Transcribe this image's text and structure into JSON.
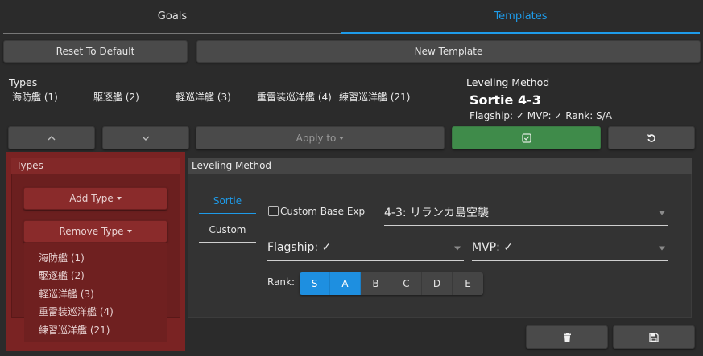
{
  "tabs": [
    {
      "label": "Goals",
      "active": false
    },
    {
      "label": "Templates",
      "active": true
    }
  ],
  "toolbar": {
    "reset_label": "Reset To Default",
    "new_template_label": "New Template"
  },
  "types_section": {
    "heading": "Types",
    "items": [
      "海防艦 (1)",
      "駆逐艦 (2)",
      "軽巡洋艦 (3)",
      "重雷装巡洋艦 (4)",
      "練習巡洋艦 (21)"
    ]
  },
  "leveling_method": {
    "heading": "Leveling Method",
    "title": "Sortie 4-3",
    "subtitle": "Flagship: ✓ MVP: ✓ Rank: S/A"
  },
  "actions": {
    "up_icon": "chevron-up-icon",
    "down_icon": "chevron-down-icon",
    "apply_to_label": "Apply to",
    "confirm_icon": "check-square-icon",
    "undo_icon": "undo-icon"
  },
  "types_panel": {
    "heading": "Types",
    "add_type_label": "Add Type",
    "remove_type_label": "Remove Type",
    "remove_options": [
      "海防艦 (1)",
      "駆逐艦 (2)",
      "軽巡洋艦 (3)",
      "重雷装巡洋艦 (4)",
      "練習巡洋艦 (21)"
    ]
  },
  "lm_panel": {
    "heading": "Leveling Method",
    "tab_sortie": "Sortie",
    "tab_custom": "Custom",
    "custom_base_exp_label": "Custom Base Exp",
    "custom_base_exp_checked": false,
    "map_value": "4-3: リランカ島空襲",
    "flagship_value": "Flagship: ✓",
    "mvp_value": "MVP: ✓",
    "rank_label": "Rank:",
    "ranks": [
      {
        "label": "S",
        "selected": true
      },
      {
        "label": "A",
        "selected": true
      },
      {
        "label": "B",
        "selected": false
      },
      {
        "label": "C",
        "selected": false
      },
      {
        "label": "D",
        "selected": false
      },
      {
        "label": "E",
        "selected": false
      }
    ]
  },
  "footer": {
    "delete_icon": "trash-icon",
    "save_icon": "save-icon"
  },
  "colors": {
    "accent": "#1e9be9",
    "success": "#3f8b4a",
    "danger_panel": "#7a2323",
    "background": "#2b2b2b"
  }
}
